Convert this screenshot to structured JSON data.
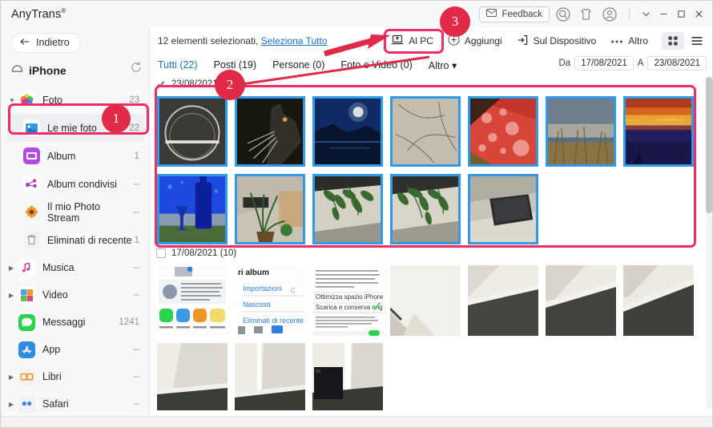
{
  "window": {
    "brand": "AnyTrans",
    "brand_mark": "®",
    "feedback_label": "Feedback",
    "icons": [
      "search-icon",
      "tshirt-icon",
      "account-icon"
    ],
    "controls": [
      "chevron-down-icon",
      "minimize-icon",
      "maximize-icon",
      "close-icon"
    ]
  },
  "sidebar": {
    "back_label": "Indietro",
    "refresh_icon": "refresh-icon",
    "device_name": "iPhone",
    "device_icon": "device-icon",
    "items": [
      {
        "label": "Foto",
        "count": "23",
        "icon": "photos-icon",
        "caret": true,
        "indent": 0,
        "selected": false
      },
      {
        "label": "Le mie foto",
        "count": "22",
        "icon": "my-photos-icon",
        "caret": false,
        "indent": 1,
        "selected": true
      },
      {
        "label": "Album",
        "count": "1",
        "icon": "album-icon",
        "caret": false,
        "indent": 1,
        "selected": false
      },
      {
        "label": "Album condivisi",
        "count": "--",
        "icon": "shared-album-icon",
        "caret": false,
        "indent": 1,
        "selected": false
      },
      {
        "label": "Il mio Photo Stream",
        "count": "--",
        "icon": "photo-stream-icon",
        "caret": false,
        "indent": 1,
        "selected": false
      },
      {
        "label": "Eliminati di recente",
        "count": "1",
        "icon": "trash-icon",
        "caret": false,
        "indent": 1,
        "selected": false
      },
      {
        "label": "Musica",
        "count": "--",
        "icon": "music-icon",
        "caret": true,
        "indent": 0,
        "selected": false
      },
      {
        "label": "Video",
        "count": "--",
        "icon": "video-icon",
        "caret": true,
        "indent": 0,
        "selected": false
      },
      {
        "label": "Messaggi",
        "count": "1241",
        "icon": "messages-icon",
        "caret": false,
        "indent": 0,
        "selected": false
      },
      {
        "label": "App",
        "count": "--",
        "icon": "appstore-icon",
        "caret": false,
        "indent": 0,
        "selected": false
      },
      {
        "label": "Libri",
        "count": "--",
        "icon": "books-icon",
        "caret": true,
        "indent": 0,
        "selected": false
      },
      {
        "label": "Safari",
        "count": "--",
        "icon": "safari-icon",
        "caret": true,
        "indent": 0,
        "selected": false
      }
    ]
  },
  "toolbar": {
    "selection_text": "12 elementi selezionati,",
    "select_all_label": "Seleziona Tutto",
    "to_pc_label": "Al PC",
    "to_pc_icon": "export-to-pc-icon",
    "add_label": "Aggiungi",
    "add_icon": "plus-circle-icon",
    "to_device_label": "Sul Dispositivo",
    "to_device_icon": "to-device-icon",
    "more_label": "Altro",
    "more_icon": "ellipsis-icon",
    "grid_view_icon": "grid-view-icon",
    "list_view_icon": "list-view-icon",
    "active_view": "grid"
  },
  "tabs": [
    {
      "label": "Tutti (22)",
      "active": true
    },
    {
      "label": "Posti (19)",
      "active": false
    },
    {
      "label": "Persone (0)",
      "active": false
    },
    {
      "label": "Foto e Video (0)",
      "active": false
    },
    {
      "label": "Altro ▾",
      "active": false
    }
  ],
  "date_filter": {
    "from_label": "Da",
    "from_value": "17/08/2021",
    "to_label": "A",
    "to_value": "23/08/2021"
  },
  "groups": [
    {
      "date": "23/08/2021",
      "checked": true,
      "photos": [
        {
          "name": "metal-bowl-rim",
          "selected": true
        },
        {
          "name": "black-cat-profile",
          "selected": true
        },
        {
          "name": "moonlit-sea",
          "selected": true
        },
        {
          "name": "dry-grass-texture",
          "selected": true
        },
        {
          "name": "red-leaf-waterdrops",
          "selected": true
        },
        {
          "name": "beach-dune-grass",
          "selected": true
        },
        {
          "name": "orange-sunset-sea",
          "selected": true
        },
        {
          "name": "blue-bottle-glass",
          "selected": true
        },
        {
          "name": "indoor-plant-window",
          "selected": true
        },
        {
          "name": "hanging-plant-wall-1",
          "selected": true
        },
        {
          "name": "hanging-plant-wall-2",
          "selected": true
        },
        {
          "name": "phone-on-table",
          "selected": true
        }
      ]
    },
    {
      "date": "17/08/2021 (10)",
      "checked": false,
      "photos": [
        {
          "name": "ios-widgets-screenshot",
          "selected": false
        },
        {
          "name": "ios-albums-screenshot",
          "selected": false
        },
        {
          "name": "ios-icloud-settings-screenshot",
          "selected": false
        },
        {
          "name": "white-wall-corner-1",
          "selected": false
        },
        {
          "name": "wall-floor-corner-1",
          "selected": false
        },
        {
          "name": "wall-floor-corner-2",
          "selected": false
        },
        {
          "name": "wall-floor-corner-3",
          "selected": false
        },
        {
          "name": "wall-shadow-floor-1",
          "selected": false
        },
        {
          "name": "wall-shadow-floor-2",
          "selected": false
        },
        {
          "name": "black-case-by-wall",
          "selected": false
        }
      ]
    }
  ],
  "annotations": [
    {
      "badge": "1",
      "target": "sidebar-le-mie-foto"
    },
    {
      "badge": "2",
      "target": "selected-photos-grid"
    },
    {
      "badge": "3",
      "target": "al-pc-button"
    }
  ]
}
